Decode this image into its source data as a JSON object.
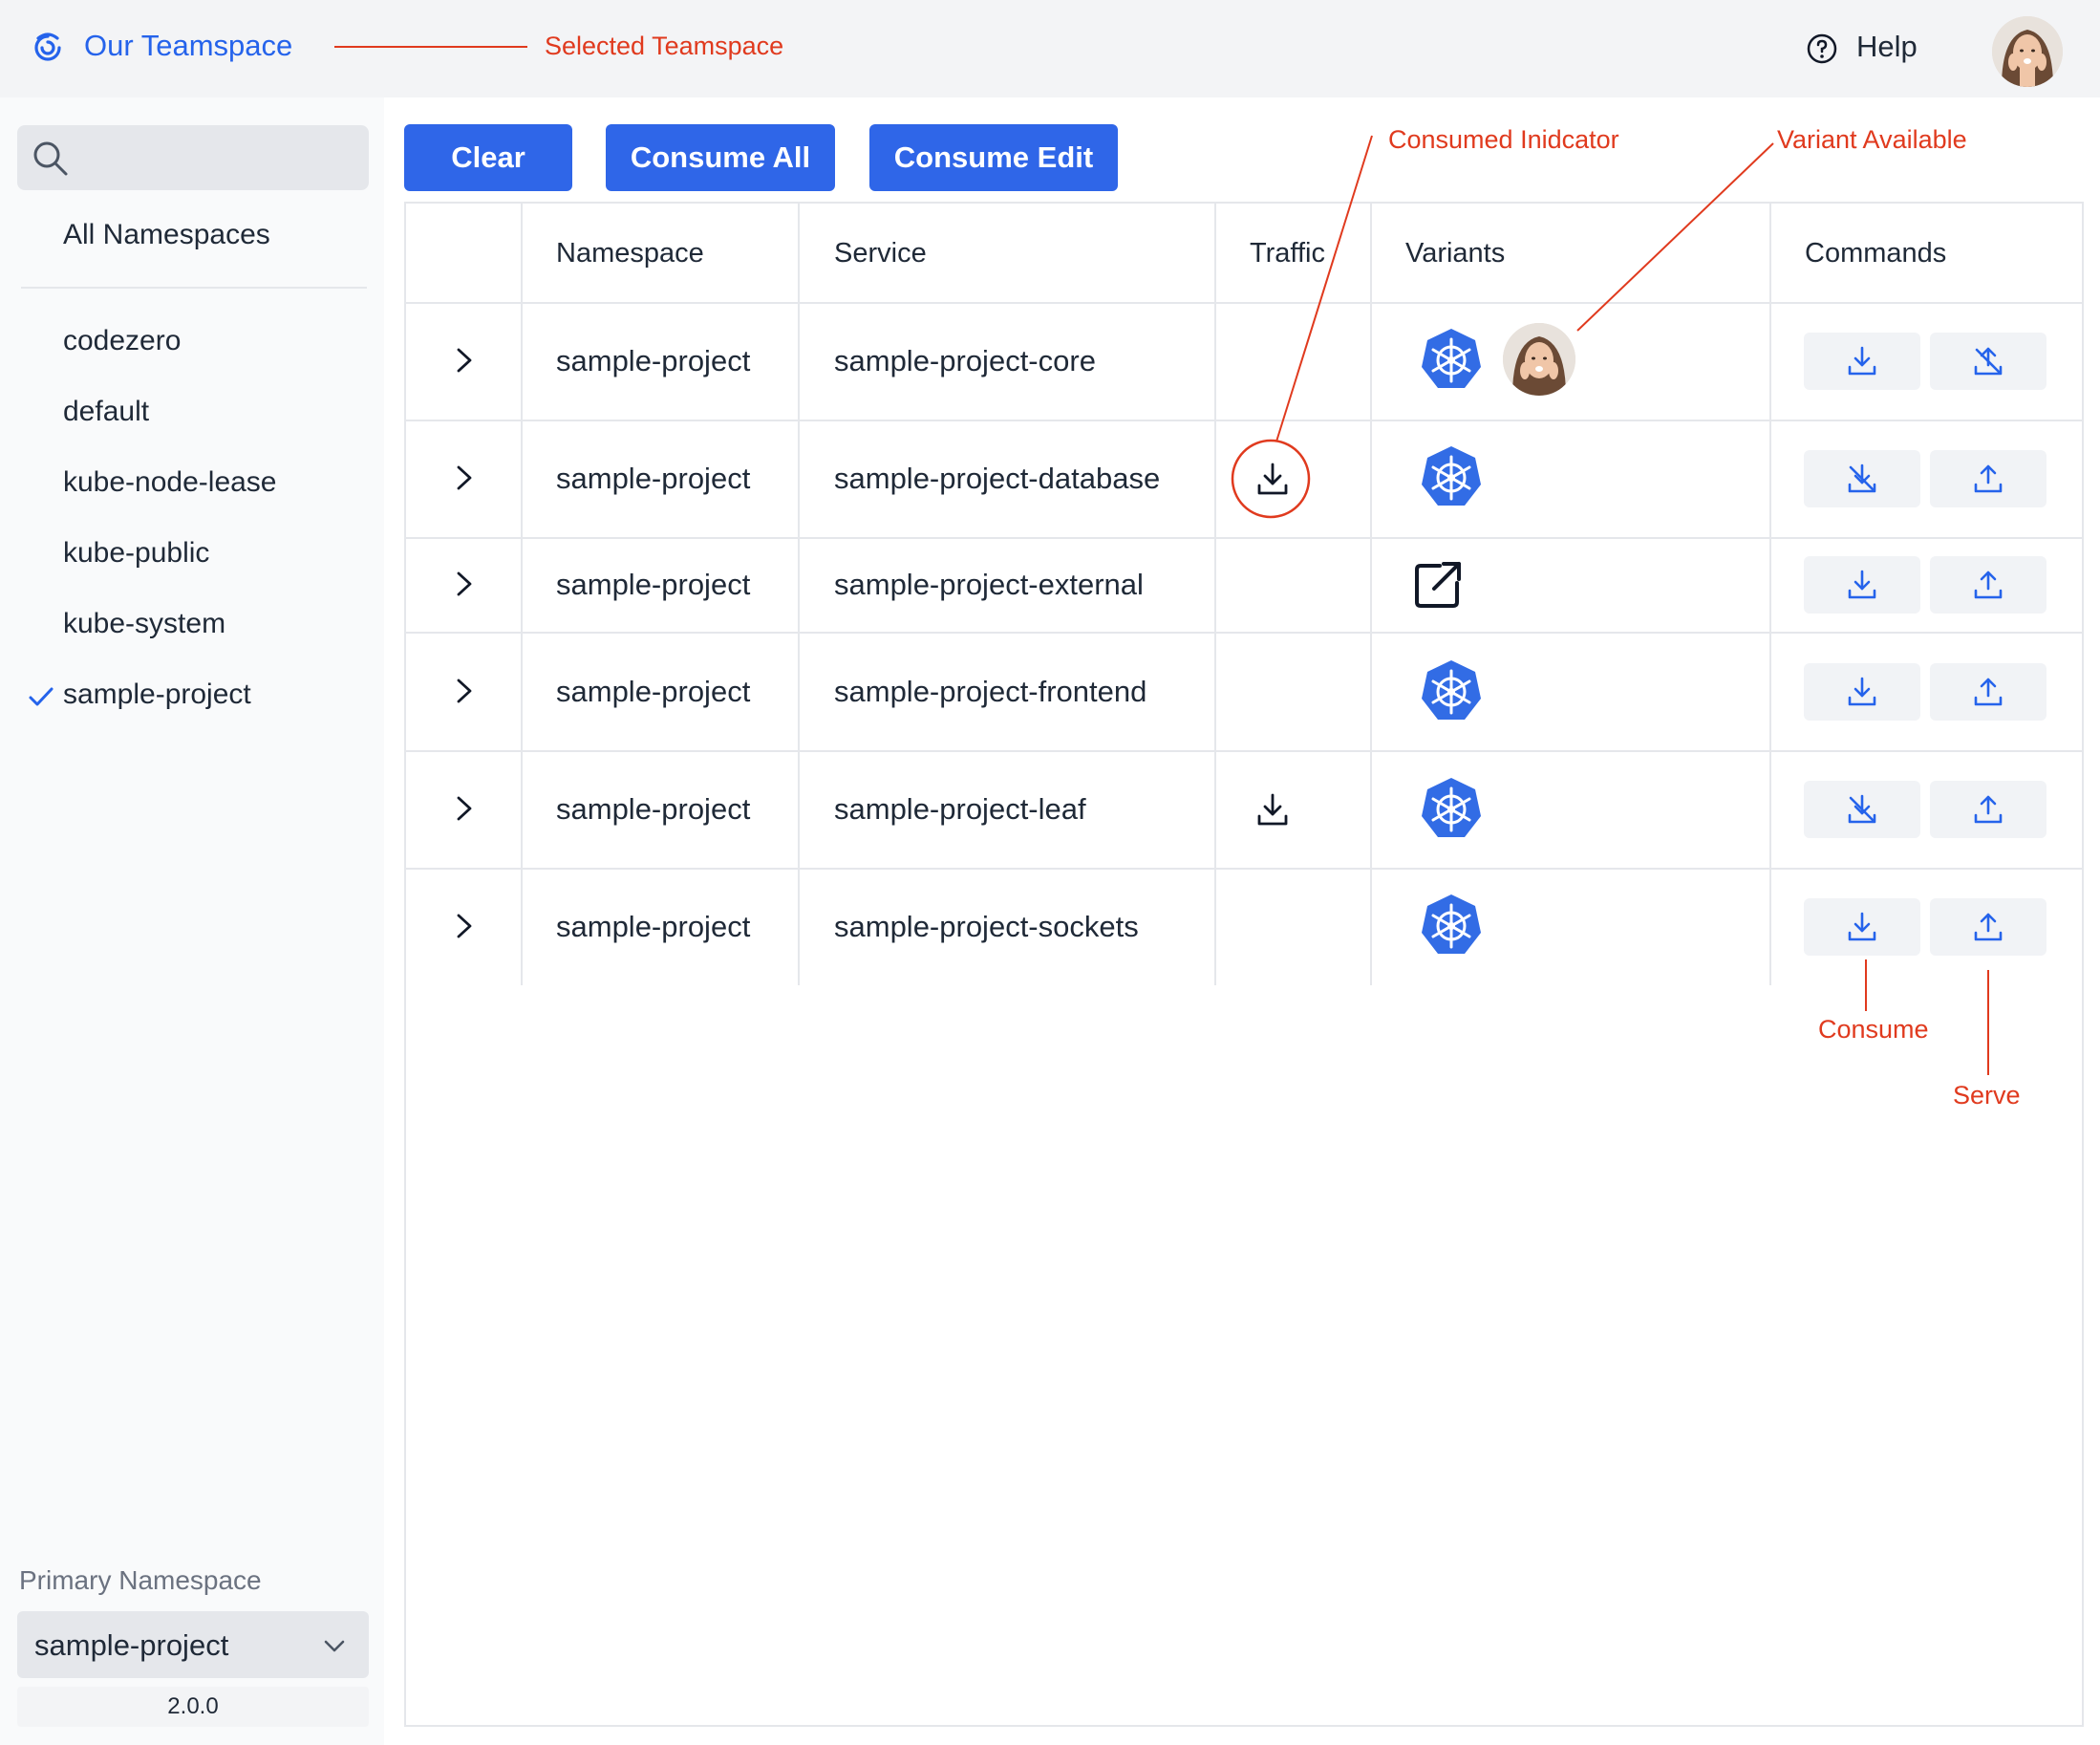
{
  "header": {
    "teamspace_name": "Our Teamspace",
    "help_label": "Help",
    "teamspace_icon": "teamspace-logo-icon",
    "help_icon": "question-circle-icon",
    "avatar": "user-avatar"
  },
  "sidebar": {
    "search_placeholder": "",
    "all_namespaces_label": "All Namespaces",
    "namespaces": [
      "codezero",
      "default",
      "kube-node-lease",
      "kube-public",
      "kube-system",
      "sample-project"
    ],
    "selected_namespace": "sample-project",
    "primary_namespace_label": "Primary Namespace",
    "primary_namespace_value": "sample-project",
    "version": "2.0.0"
  },
  "toolbar": {
    "clear_label": "Clear",
    "consume_all_label": "Consume All",
    "consume_edit_label": "Consume Edit"
  },
  "table": {
    "headers": {
      "namespace": "Namespace",
      "service": "Service",
      "traffic": "Traffic",
      "variants": "Variants",
      "commands": "Commands"
    },
    "rows": [
      {
        "namespace": "sample-project",
        "service": "sample-project-core",
        "traffic": "",
        "variants": [
          "kubernetes",
          "user-avatar"
        ],
        "consume": "consume-icon",
        "serve": "serve-disabled-icon"
      },
      {
        "namespace": "sample-project",
        "service": "sample-project-database",
        "traffic": "consumed-icon",
        "variants": [
          "kubernetes"
        ],
        "consume": "consume-disabled-icon",
        "serve": "serve-icon"
      },
      {
        "namespace": "sample-project",
        "service": "sample-project-external",
        "traffic": "",
        "variants": [
          "external-link"
        ],
        "consume": "consume-icon",
        "serve": "serve-icon"
      },
      {
        "namespace": "sample-project",
        "service": "sample-project-frontend",
        "traffic": "",
        "variants": [
          "kubernetes"
        ],
        "consume": "consume-icon",
        "serve": "serve-icon"
      },
      {
        "namespace": "sample-project",
        "service": "sample-project-leaf",
        "traffic": "consumed-icon",
        "variants": [
          "kubernetes"
        ],
        "consume": "consume-disabled-icon",
        "serve": "serve-icon"
      },
      {
        "namespace": "sample-project",
        "service": "sample-project-sockets",
        "traffic": "",
        "variants": [
          "kubernetes"
        ],
        "consume": "consume-icon",
        "serve": "serve-icon"
      }
    ]
  },
  "annotations": {
    "selected_teamspace": "Selected Teamspace",
    "consumed_indicator": "Consumed Inidcator",
    "variant_available": "Variant Available",
    "consume": "Consume",
    "serve": "Serve"
  },
  "colors": {
    "accent": "#2f66e8",
    "annotation": "#e03a1e",
    "kubernetes": "#326ce5",
    "icon_blue": "#2563eb"
  }
}
